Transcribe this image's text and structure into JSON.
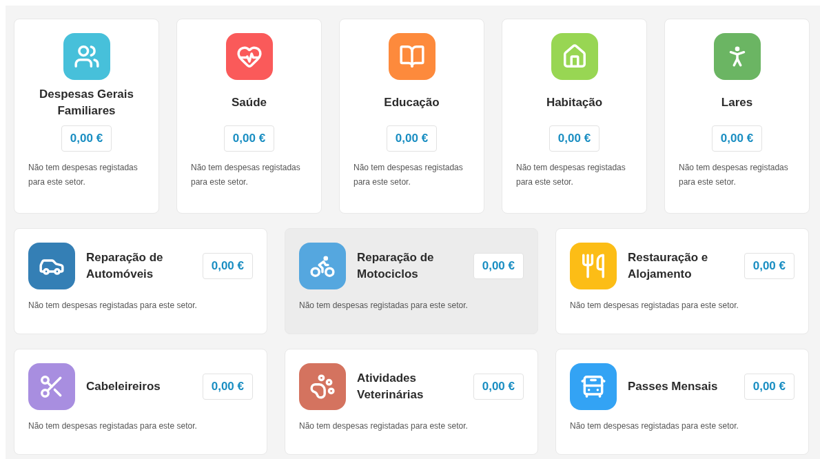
{
  "top_sectors": [
    {
      "title": "Despesas Gerais Familiares",
      "amount": "0,00 €",
      "note": "Não tem despesas registadas para este setor.",
      "color": "#47c0da",
      "selected": false
    },
    {
      "title": "Saúde",
      "amount": "0,00 €",
      "note": "Não tem despesas registadas para este setor.",
      "color": "#fa5a5a",
      "selected": false
    },
    {
      "title": "Educação",
      "amount": "0,00 €",
      "note": "Não tem despesas registadas para este setor.",
      "color": "#fd8a3c",
      "selected": false
    },
    {
      "title": "Habitação",
      "amount": "0,00 €",
      "note": "Não tem despesas registadas para este setor.",
      "color": "#98d653",
      "selected": false
    },
    {
      "title": "Lares",
      "amount": "0,00 €",
      "note": "Não tem despesas registadas para este setor.",
      "color": "#6bb563",
      "selected": false
    }
  ],
  "other_sectors": [
    {
      "title": "Reparação de Automóveis",
      "amount": "0,00 €",
      "note": "Não tem despesas registadas para este setor.",
      "color": "#347fb5",
      "selected": false
    },
    {
      "title": "Reparação de Motociclos",
      "amount": "0,00 €",
      "note": "Não tem despesas registadas para este setor.",
      "color": "#55a7df",
      "selected": true
    },
    {
      "title": "Restauração e Alojamento",
      "amount": "0,00 €",
      "note": "Não tem despesas registadas para este setor.",
      "color": "#fcbd16",
      "selected": false
    },
    {
      "title": "Cabeleireiros",
      "amount": "0,00 €",
      "note": "Não tem despesas registadas para este setor.",
      "color": "#a88ee0",
      "selected": false
    },
    {
      "title": "Atividades Veterinárias",
      "amount": "0,00 €",
      "note": "Não tem despesas registadas para este setor.",
      "color": "#d4735f",
      "selected": false
    },
    {
      "title": "Passes Mensais",
      "amount": "0,00 €",
      "note": "Não tem despesas registadas para este setor.",
      "color": "#33a3f4",
      "selected": false
    }
  ]
}
